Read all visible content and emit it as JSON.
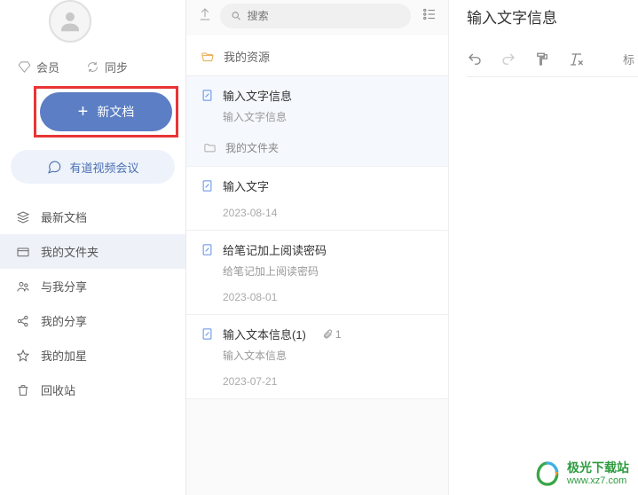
{
  "sidebar": {
    "member_label": "会员",
    "sync_label": "同步",
    "new_doc_label": "新文档",
    "meeting_label": "有道视频会议",
    "nav": [
      {
        "label": "最新文档"
      },
      {
        "label": "我的文件夹"
      },
      {
        "label": "与我分享"
      },
      {
        "label": "我的分享"
      },
      {
        "label": "我的加星"
      },
      {
        "label": "回收站"
      }
    ]
  },
  "middle": {
    "search_placeholder": "搜索",
    "crumb": "我的资源",
    "subfolder": "我的文件夹",
    "items": [
      {
        "title": "输入文字信息",
        "desc": "输入文字信息",
        "date": ""
      },
      {
        "title": "输入文字",
        "desc": "",
        "date": "2023-08-14"
      },
      {
        "title": "给笔记加上阅读密码",
        "desc": "给笔记加上阅读密码",
        "date": "2023-08-01"
      },
      {
        "title": "输入文本信息(1)",
        "desc": "输入文本信息",
        "date": "2023-07-21",
        "attach_count": "1"
      }
    ]
  },
  "right": {
    "title": "输入文字信息",
    "tag_label": "标"
  },
  "watermark": {
    "cn": "极光下载站",
    "url": "www.xz7.com"
  }
}
